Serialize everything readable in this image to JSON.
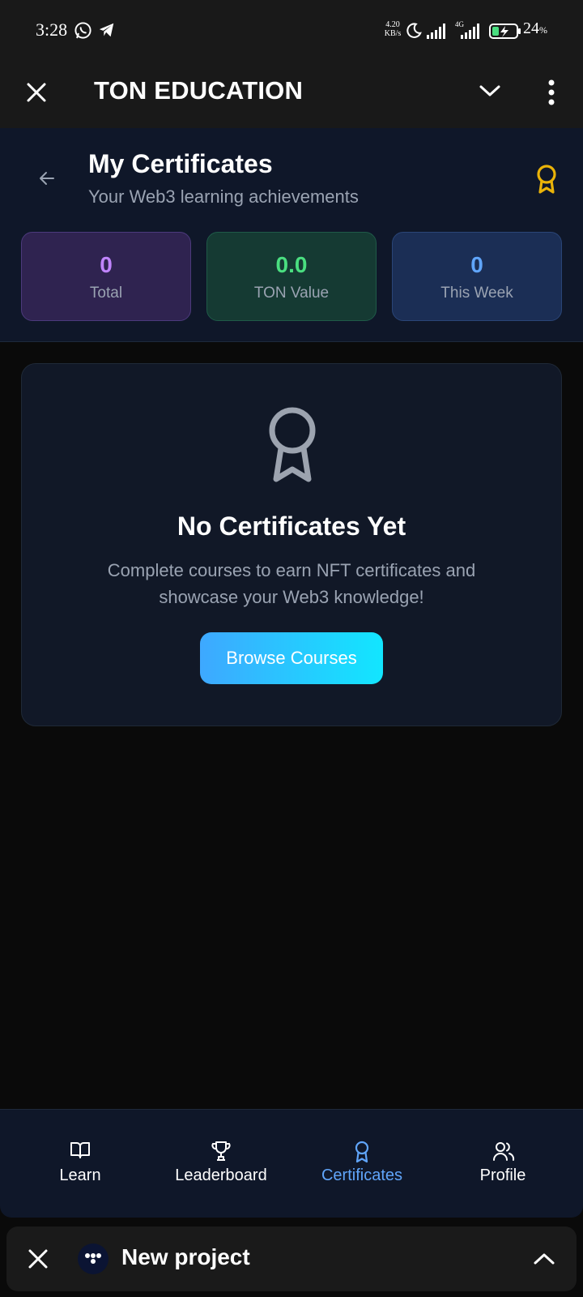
{
  "status_bar": {
    "time": "3:28",
    "net_speed_value": "4.20",
    "net_speed_unit": "KB/s",
    "network_label": "4G",
    "battery_percent": "24",
    "battery_unit": "%",
    "icons": [
      "whatsapp-icon",
      "telegram-icon",
      "moon-icon",
      "signal-icon",
      "signal-4g-icon",
      "battery-charging-icon"
    ]
  },
  "app_header": {
    "title": "TON EDUCATION",
    "icons": [
      "close-icon",
      "chevron-down-icon",
      "more-vert-icon"
    ]
  },
  "page": {
    "title": "My Certificates",
    "subtitle": "Your Web3 learning achievements"
  },
  "stats": [
    {
      "value": "0",
      "label": "Total",
      "color": "#c084fc"
    },
    {
      "value": "0.0",
      "label": "TON Value",
      "color": "#4ade80"
    },
    {
      "value": "0",
      "label": "This Week",
      "color": "#60a5fa"
    }
  ],
  "empty_state": {
    "title": "No Certificates Yet",
    "text": "Complete courses to earn NFT certificates and showcase your Web3 knowledge!",
    "button_label": "Browse Courses"
  },
  "nav": {
    "items": [
      {
        "label": "Learn",
        "icon": "book-icon"
      },
      {
        "label": "Leaderboard",
        "icon": "trophy-icon"
      },
      {
        "label": "Certificates",
        "icon": "award-icon",
        "active": true
      },
      {
        "label": "Profile",
        "icon": "users-icon"
      }
    ]
  },
  "mini_bar": {
    "title": "New project",
    "icons": [
      "close-icon",
      "app-logo-icon",
      "chevron-up-icon"
    ]
  },
  "colors": {
    "accent": "#60a5fa",
    "gold": "#eab308",
    "button_gradient_start": "#3ea8ff",
    "button_gradient_end": "#12e6ff"
  }
}
